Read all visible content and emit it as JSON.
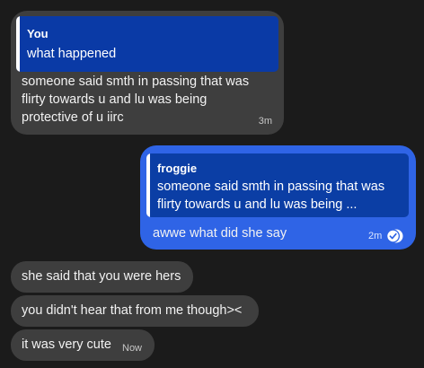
{
  "messages": [
    {
      "direction": "incoming",
      "reply": {
        "author": "You",
        "text": "what happened"
      },
      "lines": [
        "someone said smth in passing that was",
        "flirty towards u and lu was being",
        "protective of u iirc"
      ],
      "time": "3m"
    },
    {
      "direction": "outgoing",
      "reply": {
        "author": "froggie",
        "lines": [
          "someone said smth in passing that was",
          "flirty towards u and lu was being ..."
        ]
      },
      "text": "awwe what did she say",
      "time": "2m",
      "status_icon": "read-check-icon"
    },
    {
      "direction": "incoming",
      "text": "she said that you were hers"
    },
    {
      "direction": "incoming",
      "text": "you didn't hear that from me though><"
    },
    {
      "direction": "incoming",
      "text": "it was very cute",
      "time": "Now"
    }
  ],
  "colors": {
    "background": "#1b1b1b",
    "incoming_bubble": "#3e3e3e",
    "outgoing_bubble": "#2f64e6",
    "incoming_quote": "#0a3aa6",
    "outgoing_quote": "#0b3ea5"
  }
}
